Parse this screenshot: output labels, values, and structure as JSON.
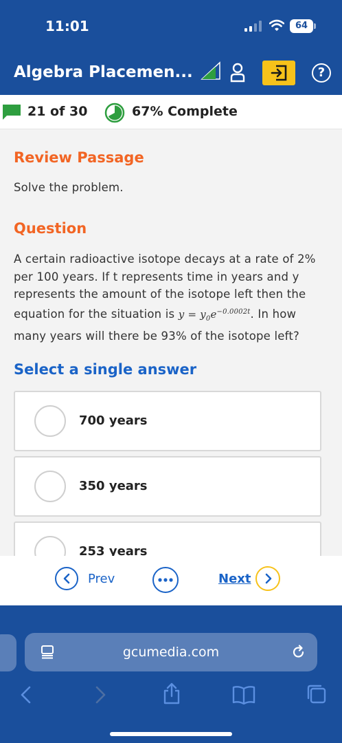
{
  "status_bar": {
    "time": "11:01",
    "battery": "64"
  },
  "header": {
    "title": "Algebra Placemen..."
  },
  "progress": {
    "count": "21 of 30",
    "complete": "67% Complete",
    "fraction": 0.67
  },
  "review": {
    "heading": "Review Passage",
    "instruction": "Solve the problem."
  },
  "question": {
    "heading": "Question",
    "text_before": "A certain radioactive isotope decays at a rate of 2% per 100 years. If t represents time in years and y represents the amount of the isotope left then the equation for the situation is ",
    "equation_lhs": "y",
    "equation_eq": " = ",
    "equation_y0": "y",
    "equation_y0_sub": "0",
    "equation_base": "e",
    "equation_exponent": "−0.0002t",
    "text_after": ". In how many years will there be 93% of the isotope left?"
  },
  "answers": {
    "heading": "Select a single answer",
    "options": [
      {
        "label": "700 years"
      },
      {
        "label": "350 years"
      },
      {
        "label": "253 years"
      }
    ]
  },
  "nav": {
    "prev": "Prev",
    "next": "Next"
  },
  "browser": {
    "url": "gcumedia.com"
  },
  "colors": {
    "primary_blue": "#1a4f9c",
    "accent_orange": "#f26524",
    "link_blue": "#1a63c7",
    "accent_yellow": "#f7c21a",
    "progress_green": "#2e9e3f"
  },
  "icons": {
    "status": [
      "signal-icon",
      "wifi-icon",
      "battery-icon"
    ],
    "header": [
      "signal-triangle-icon",
      "person-icon",
      "exit-icon",
      "help-icon"
    ],
    "progress": [
      "chat-flag-icon",
      "progress-pie-icon"
    ],
    "nav": [
      "chevron-left-icon",
      "more-icon",
      "chevron-right-icon"
    ],
    "browser": [
      "tabs-icon",
      "reload-icon",
      "back-icon",
      "forward-icon",
      "share-icon",
      "bookmarks-icon",
      "tab-overview-icon"
    ]
  }
}
